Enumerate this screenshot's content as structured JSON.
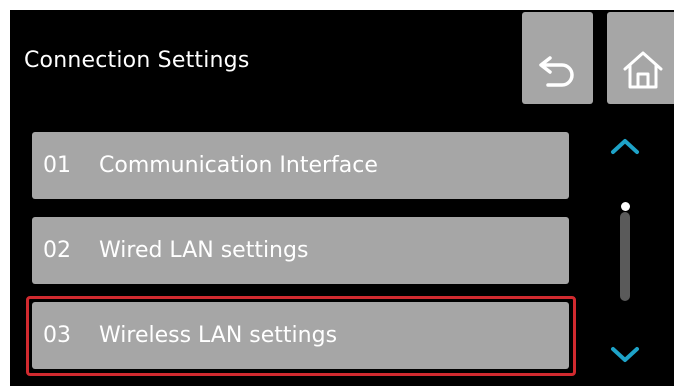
{
  "header": {
    "title": "Connection Settings",
    "back_icon": "undo-arrow-icon",
    "home_icon": "home-icon"
  },
  "menu": {
    "items": [
      {
        "number": "01",
        "label": "Communication Interface"
      },
      {
        "number": "02",
        "label": "Wired LAN settings"
      },
      {
        "number": "03",
        "label": "Wireless LAN settings"
      }
    ],
    "selected_index": 2
  },
  "scroll": {
    "up_icon": "chevron-up-icon",
    "down_icon": "chevron-down-icon",
    "position": 0
  },
  "colors": {
    "background": "#000000",
    "button": "#a6a6a6",
    "accent": "#1ea3c8",
    "selection": "#d12a2f",
    "text": "#ffffff"
  }
}
